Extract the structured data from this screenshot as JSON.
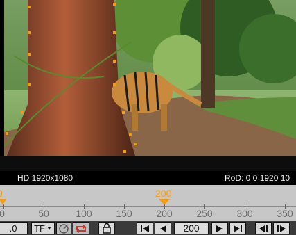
{
  "viewer": {
    "image_description_icon": "tiger-forest-footage",
    "format_label": "HD 1920x1080",
    "rod_label": "RoD: 0 0 1920 10"
  },
  "timeline": {
    "current_frame_label": "200",
    "start_label": "0",
    "tick_labels": [
      "0",
      "50",
      "100",
      "150",
      "200",
      "250",
      "300",
      "350"
    ]
  },
  "controls": {
    "left_value": ".0",
    "tf_label": "TF",
    "frame_value": "200",
    "icons": [
      "turbo-gauge-icon",
      "loop-icon",
      "lock-icon",
      "first-frame-icon",
      "play-backward-icon",
      "play-forward-icon",
      "last-frame-icon",
      "previous-keyframe-icon",
      "next-keyframe-icon"
    ]
  },
  "colors": {
    "accent": "#f39c12",
    "viewer_bg": "#000000",
    "timeline_bg": "#c7c7c7"
  }
}
